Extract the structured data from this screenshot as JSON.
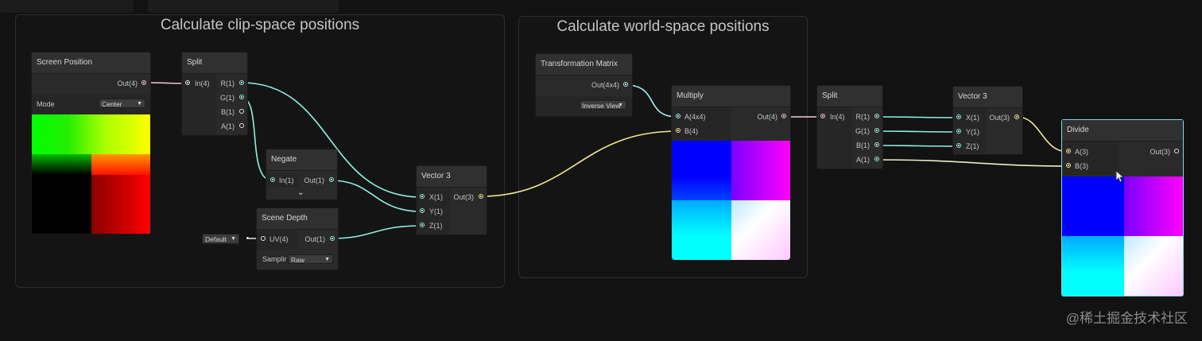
{
  "groups": {
    "clip_space": {
      "title": "Calculate clip-space positions"
    },
    "world_space": {
      "title": "Calculate world-space positions"
    }
  },
  "nodes": {
    "screen_position": {
      "title": "Screen Position",
      "out": "Out(4)",
      "mode_label": "Mode",
      "mode_value": "Center"
    },
    "split_1": {
      "title": "Split",
      "in": "In(4)",
      "outs": [
        "R(1)",
        "G(1)",
        "B(1)",
        "A(1)"
      ]
    },
    "negate": {
      "title": "Negate",
      "in": "In(1)",
      "out": "Out(1)"
    },
    "scene_depth": {
      "title": "Scene Depth",
      "in": "UV(4)",
      "out": "Out(1)",
      "sampling_label": "Samplir",
      "sampling_value": "Raw",
      "uv_default": "Default"
    },
    "vector3_1": {
      "title": "Vector 3",
      "ins": [
        "X(1)",
        "Y(1)",
        "Z(1)"
      ],
      "out": "Out(3)"
    },
    "transformation_matrix": {
      "title": "Transformation Matrix",
      "out": "Out(4x4)",
      "type_value": "Inverse View"
    },
    "multiply": {
      "title": "Multiply",
      "ins": [
        "A(4x4)",
        "B(4)"
      ],
      "out": "Out(4)"
    },
    "split_2": {
      "title": "Split",
      "in": "In(4)",
      "outs": [
        "R(1)",
        "G(1)",
        "B(1)",
        "A(1)"
      ]
    },
    "vector3_2": {
      "title": "Vector 3",
      "ins": [
        "X(1)",
        "Y(1)",
        "Z(1)"
      ],
      "out": "Out(3)"
    },
    "divide": {
      "title": "Divide",
      "ins": [
        "A(3)",
        "B(3)"
      ],
      "out": "Out(3)"
    }
  },
  "watermark": "@稀土掘金技术社区",
  "colors": {
    "wire_vec1": "#8ef1e0",
    "wire_vec3": "#f1e98c",
    "wire_vec4": "#f3c6dc",
    "wire_matrix": "#a4f2f2",
    "selection": "#7fd7ee"
  }
}
